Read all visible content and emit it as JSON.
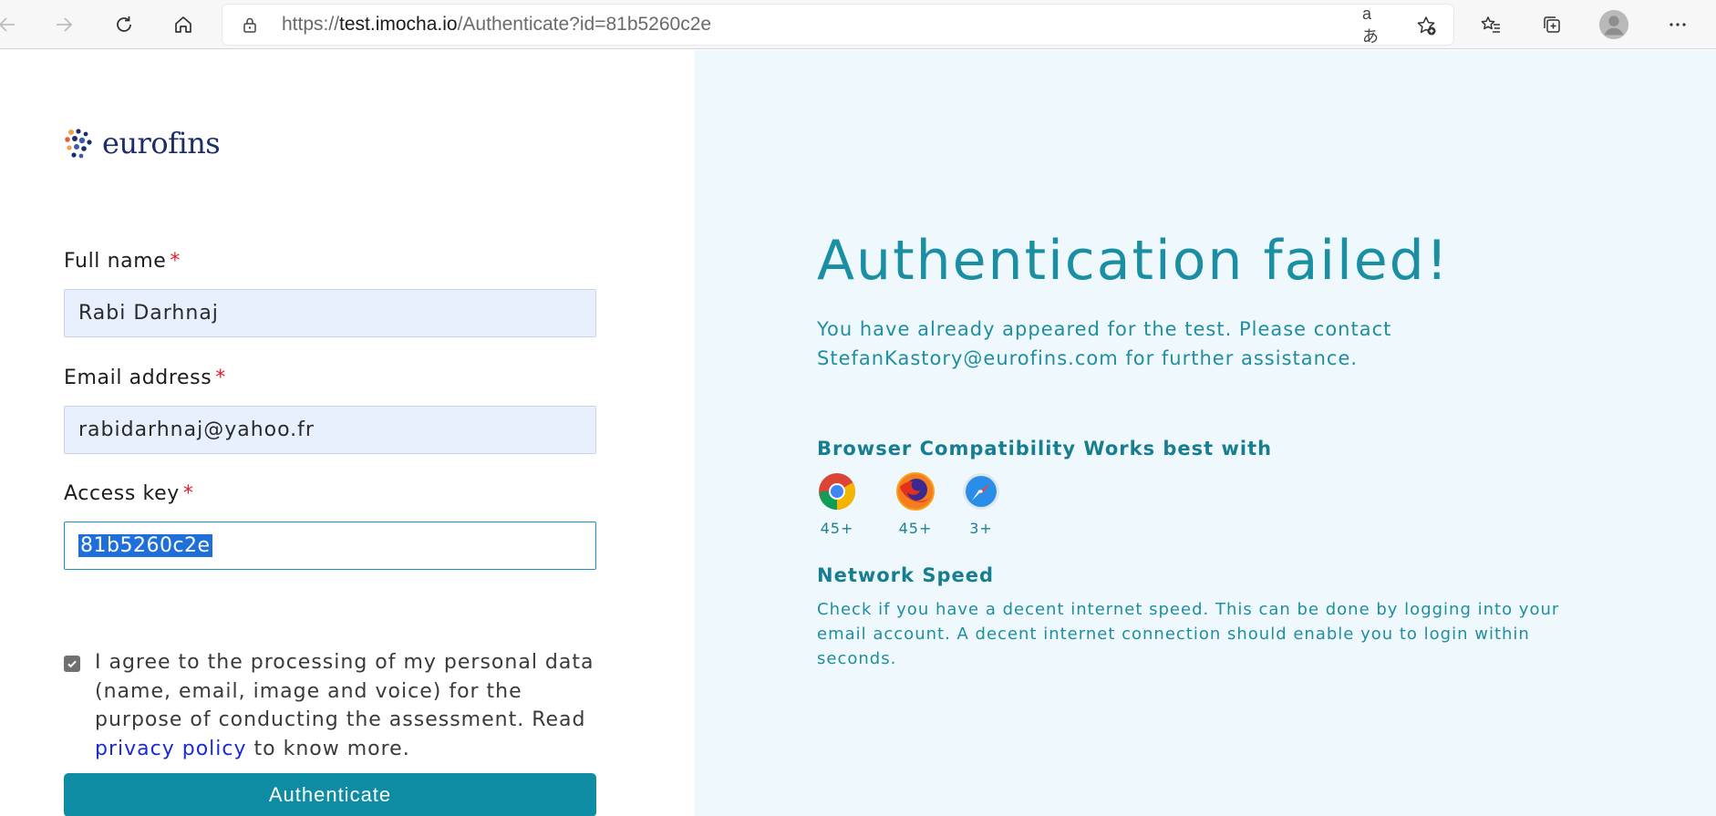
{
  "browser": {
    "url_prefix": "https://",
    "url_host": "test.imocha.io",
    "url_path": "/Authenticate?id=81b5260c2e",
    "read_aloud_label": "aあ"
  },
  "brand": {
    "name": "eurofins"
  },
  "form": {
    "full_name_label": "Full name",
    "full_name_value": "Rabi Darhnaj",
    "email_label": "Email address",
    "email_value": "rabidarhnaj@yahoo.fr",
    "access_key_label": "Access key",
    "access_key_value": "81b5260c2e",
    "required_mark": "*",
    "consent_text_before": "I agree to the processing of my personal data (name, email, image and voice) for the purpose of conducting the assessment. Read ",
    "consent_link": "privacy policy",
    "consent_text_after": " to know more.",
    "consent_checked": true,
    "submit_label": "Authenticate"
  },
  "message": {
    "title": "Authentication failed!",
    "body": "You have already appeared for the test. Please contact StefanKastory@eurofins.com for further assistance."
  },
  "compatibility": {
    "title": "Browser Compatibility Works best with",
    "browsers": [
      {
        "name": "chrome-icon",
        "version": "45+"
      },
      {
        "name": "firefox-icon",
        "version": "45+"
      },
      {
        "name": "safari-icon",
        "version": "3+"
      }
    ]
  },
  "network": {
    "title": "Network Speed",
    "body": "Check if you have a decent internet speed. This can be done by logging into your email account. A decent internet connection should enable you to login within seconds."
  },
  "colors": {
    "accent": "#0e8ca3",
    "right_pane_bg": "#eff8fc",
    "input_bg": "#e8f0fe",
    "required": "#e0202a"
  }
}
